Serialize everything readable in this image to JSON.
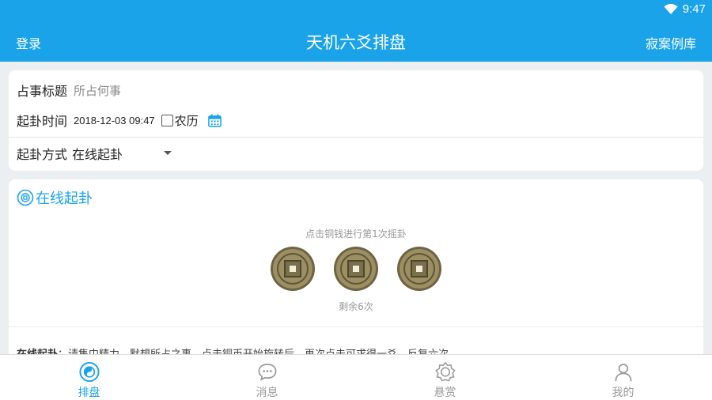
{
  "status": {
    "time": "9:47"
  },
  "nav": {
    "left": "登录",
    "title": "天机六爻排盘",
    "right": "寂案例库"
  },
  "form": {
    "subject_label": "占事标题",
    "subject_placeholder": "所占何事",
    "time_label": "起卦时间",
    "time_value": "2018-12-03 09:47",
    "lunar_label": "农历",
    "method_label": "起卦方式",
    "method_value": "在线起卦"
  },
  "online": {
    "title": "在线起卦",
    "hint": "点击铜钱进行第1次摇卦",
    "remaining": "剩余6次",
    "notice_label": "在线起卦",
    "notice_text": "：请集中精力，默想所占之事，点击铜币开始旋转后，再次点击可求得一爻，反复六次"
  },
  "tabs": [
    {
      "label": "排盘",
      "icon": "bagua-icon"
    },
    {
      "label": "消息",
      "icon": "message-icon"
    },
    {
      "label": "悬赏",
      "icon": "reward-icon"
    },
    {
      "label": "我的",
      "icon": "user-icon"
    }
  ],
  "colors": {
    "primary": "#1aa3e8",
    "background": "#eceff1"
  }
}
